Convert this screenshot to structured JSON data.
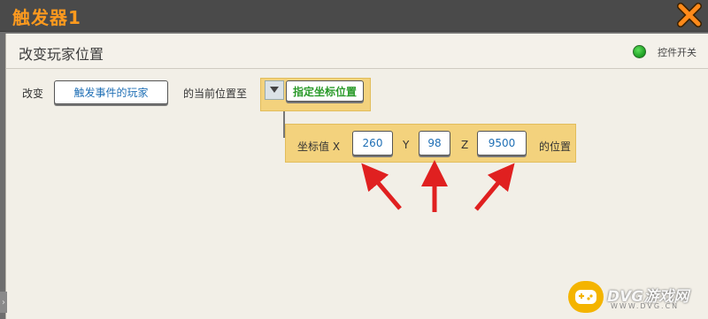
{
  "window": {
    "title": "触发器1",
    "close_icon": "close-x-icon"
  },
  "header": {
    "section_title": "改变玩家位置",
    "toggle_label": "控件开关",
    "toggle_state": "on",
    "toggle_color": "#23a829"
  },
  "action_row": {
    "prefix": "改变",
    "target_button": "触发事件的玩家",
    "middle": "的当前位置至",
    "mode_button": "指定坐标位置",
    "dropdown_icon": "triangle-down-icon"
  },
  "coords": {
    "label": "坐标值 X",
    "x_value": "260",
    "y_label": "Y",
    "y_value": "98",
    "z_label": "Z",
    "z_value": "9500",
    "suffix": "的位置"
  },
  "watermark": {
    "text": "DVG游戏网",
    "sub": "WWW.DVG.CN"
  },
  "colors": {
    "title": "#ff9a1e",
    "highlight": "#f3d27d",
    "arrow": "#e02020",
    "value_text": "#1f6fb5",
    "mode_text": "#2a9a2a"
  }
}
